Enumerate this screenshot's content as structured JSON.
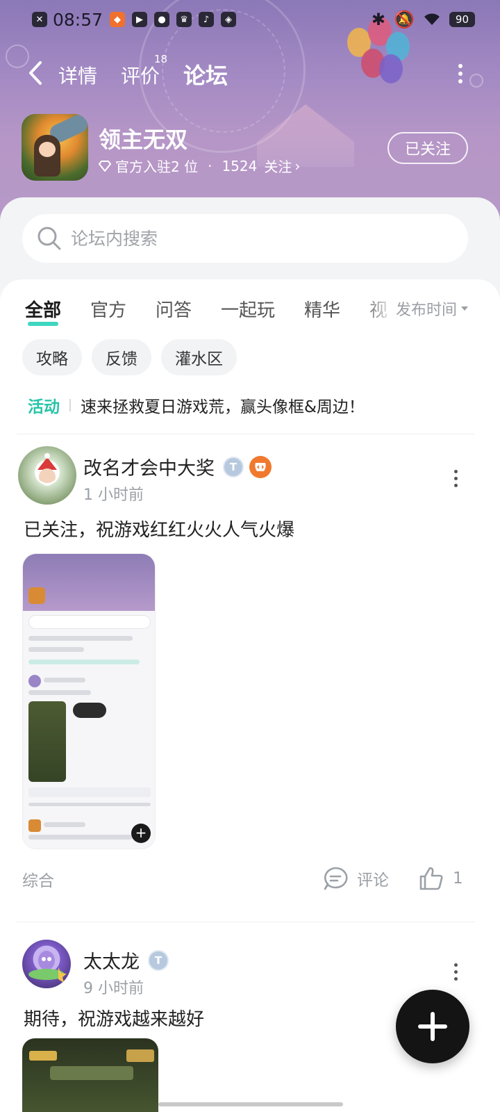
{
  "status_bar": {
    "time": "08:57",
    "battery": "90"
  },
  "nav": {
    "tabs": [
      "详情",
      "评价",
      "论坛"
    ],
    "review_count": "18",
    "active_tab": "论坛"
  },
  "game": {
    "title": "领主无双",
    "official_label": "官方入驻2 位",
    "followers": "1524",
    "followers_suffix": "关注",
    "follow_button": "已关注"
  },
  "search": {
    "placeholder": "论坛内搜索"
  },
  "category_tabs": [
    "全部",
    "官方",
    "问答",
    "一起玩",
    "精华",
    "视"
  ],
  "sort_label": "发布时间",
  "chips": [
    "攻略",
    "反馈",
    "灌水区"
  ],
  "activity": {
    "tag": "活动",
    "text": "速来拯救夏日游戏荒，赢头像框&周边！"
  },
  "posts": [
    {
      "author": "改名才会中大奖",
      "time": "1 小时前",
      "text": "已关注，祝游戏红红火火人气火爆",
      "category": "综合",
      "comment_label": "评论",
      "like_count": "1"
    },
    {
      "author": "太太龙",
      "time": "9 小时前",
      "text": "期待，祝游戏越来越好"
    }
  ],
  "colors": {
    "accent": "#3fd6c0",
    "activity": "#27c4a8",
    "header_purple": "#a58bc4"
  }
}
